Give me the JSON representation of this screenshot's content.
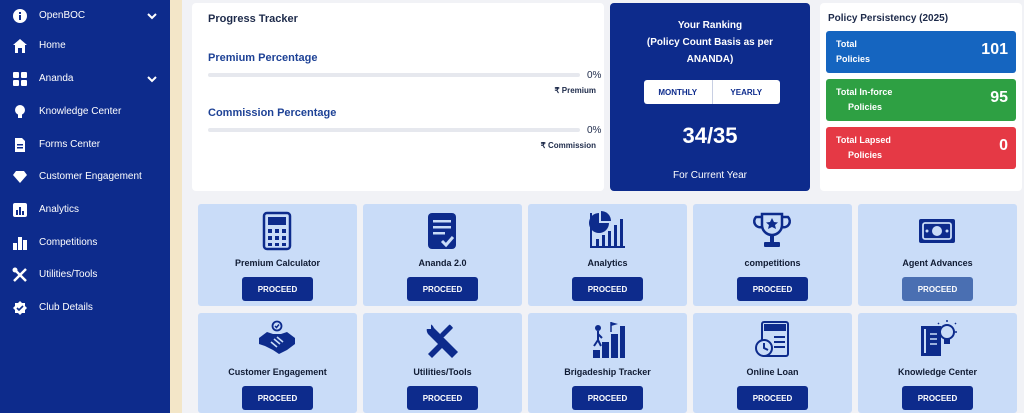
{
  "sidebar": {
    "items": [
      {
        "label": "OpenBOC",
        "icon": "info-icon",
        "expandable": true
      },
      {
        "label": "Home",
        "icon": "home-icon",
        "expandable": false
      },
      {
        "label": "Ananda",
        "icon": "grid-icon",
        "expandable": true
      },
      {
        "label": "Knowledge Center",
        "icon": "lightbulb-icon",
        "expandable": false
      },
      {
        "label": "Forms Center",
        "icon": "document-icon",
        "expandable": false
      },
      {
        "label": "Customer Engagement",
        "icon": "diamond-icon",
        "expandable": false
      },
      {
        "label": "Analytics",
        "icon": "chart-icon",
        "expandable": false
      },
      {
        "label": "Competitions",
        "icon": "bar-chart-icon",
        "expandable": false
      },
      {
        "label": "Utilities/Tools",
        "icon": "tools-icon",
        "expandable": false
      },
      {
        "label": "Club Details",
        "icon": "badge-icon",
        "expandable": false
      }
    ]
  },
  "progress": {
    "title": "Progress Tracker",
    "premium_label": "Premium Percentage",
    "premium_pct": "0%",
    "premium_fraction": 0,
    "premium_sub": "₹ Premium",
    "commission_label": "Commission Percentage",
    "commission_pct": "0%",
    "commission_fraction": 0,
    "commission_sub": "₹ Commission"
  },
  "ranking": {
    "title_line1": "Your Ranking",
    "title_line2": "(Policy Count Basis as per",
    "title_line3": "ANANDA)",
    "monthly_label": "MONTHLY",
    "yearly_label": "YEARLY",
    "value": "34/35",
    "footer": "For Current Year"
  },
  "persistency": {
    "title": "Policy Persistency (2025)",
    "total": {
      "line1": "Total",
      "line2": "Policies",
      "value": "101",
      "color": "#1565c0"
    },
    "inforce": {
      "line1": "Total In-force",
      "line2": "Policies",
      "value": "95",
      "color": "#2ea043"
    },
    "lapsed": {
      "line1": "Total Lapsed",
      "line2": "Policies",
      "value": "0",
      "color": "#e53945"
    }
  },
  "tiles": [
    {
      "label": "Premium Calculator",
      "button": "PROCEED",
      "icon": "calculator-icon"
    },
    {
      "label": "Ananda 2.0",
      "button": "PROCEED",
      "icon": "clipboard-check-icon"
    },
    {
      "label": "Analytics",
      "button": "PROCEED",
      "icon": "analytics-chart-icon"
    },
    {
      "label": "competitions",
      "button": "PROCEED",
      "icon": "trophy-icon"
    },
    {
      "label": "Agent Advances",
      "button": "PROCEED",
      "icon": "banknote-icon"
    },
    {
      "label": "Customer Engagement",
      "button": "PROCEED",
      "icon": "handshake-icon"
    },
    {
      "label": "Utilities/Tools",
      "button": "PROCEED",
      "icon": "wrench-screwdriver-icon"
    },
    {
      "label": "Brigadeship Tracker",
      "button": "PROCEED",
      "icon": "stairs-flag-icon"
    },
    {
      "label": "Online Loan",
      "button": "PROCEED",
      "icon": "loan-document-icon"
    },
    {
      "label": "Knowledge Center",
      "button": "PROCEED",
      "icon": "book-bulb-icon"
    }
  ],
  "colors": {
    "sidebar_bg": "#0d2b8c",
    "accent": "#1e4296",
    "tile_bg": "#c9dcf8",
    "button_bg": "#0d2b8c",
    "button_highlight": "#4a6fb2"
  }
}
